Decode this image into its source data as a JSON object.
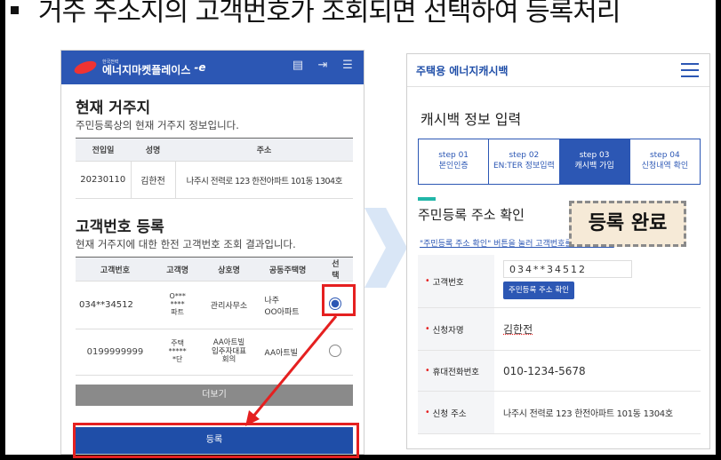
{
  "slide_title": "거주 주소지의 고객번호가 조회되면 선택하여 등록처리",
  "left": {
    "logo_sub": "한국전력",
    "logo_main": "에너지마켓플레이스",
    "logo_e": "-e",
    "residence_title": "현재 거주지",
    "residence_sub": "주민등록상의 현재 거주지 정보입니다.",
    "residence_headers": [
      "전입일",
      "성명",
      "주소"
    ],
    "residence_row": [
      "20230110",
      "김한전",
      "나주시 전력로 123 한전아파트 101동 1304호"
    ],
    "customer_title": "고객번호 등록",
    "customer_sub": "현재 거주지에 대한 한전 고객번호 조회 결과입니다.",
    "customer_headers": [
      "고객번호",
      "고객명",
      "상호명",
      "공동주택명",
      "선택"
    ],
    "customer_rows": [
      {
        "number": "034**34512",
        "name": "O***\n****\n파트",
        "business": "관리사무소",
        "complex": "나주\nOO아파트",
        "selected": true
      },
      {
        "number": "0199999999",
        "name": "주택\n*****\n*단",
        "business": "AA아트빌 입주자대표회의",
        "complex": "AA아트빌",
        "selected": false
      }
    ],
    "more_label": "더보기",
    "register_label": "등록"
  },
  "right": {
    "header_title": "주택용 에너지캐시백",
    "page_title": "캐시백 정보 입력",
    "steps": [
      {
        "label": "step 01\n본인인증",
        "active": false
      },
      {
        "label": "step 02\nEN:TER 정보입력",
        "active": false
      },
      {
        "label": "step 03\n캐시백 가입",
        "active": true
      },
      {
        "label": "step 04\n신청내역 확인",
        "active": false
      }
    ],
    "section_title": "주민등록 주소 확인",
    "note": "\"주민등록 주소 확인\" 버튼을 눌러 고객번호를 확인하세요.",
    "fields": {
      "customer_label": "고객번호",
      "customer_value": "034**34512",
      "customer_button": "주민등록 주소 확인",
      "applicant_label": "신청자명",
      "applicant_value": "김한전",
      "phone_label": "휴대전화번호",
      "phone_value": "010-1234-5678",
      "address_label": "신청 주소",
      "address_value": "나주시 전력로 123 한전아파트 101동 1304호"
    }
  },
  "callout": "등록 완료",
  "colors": {
    "brand_blue": "#2c57b4",
    "highlight_red": "#e52020",
    "accent_teal": "#21b6a8"
  }
}
